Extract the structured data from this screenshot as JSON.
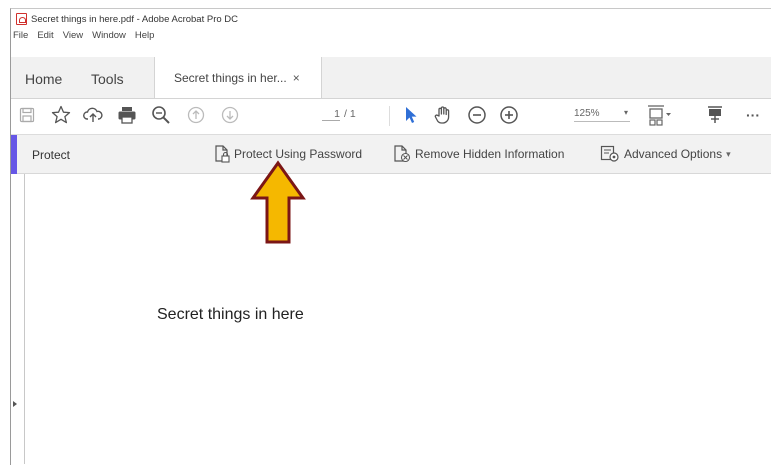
{
  "window": {
    "title": "Secret things in here.pdf - Adobe Acrobat Pro DC"
  },
  "menubar": {
    "items": [
      "File",
      "Edit",
      "View",
      "Window",
      "Help"
    ]
  },
  "tabs": {
    "home": "Home",
    "tools": "Tools",
    "document": "Secret things in her...",
    "close_glyph": "×"
  },
  "toolbar": {
    "page_current": "1",
    "page_total": "/ 1",
    "zoom": "125%",
    "zoom_chevron": "▾",
    "icons": [
      "save-icon",
      "bookmark-star-icon",
      "upload-cloud-icon",
      "print-icon",
      "search-zoom-icon",
      "page-up-icon",
      "page-down-icon",
      "select-cursor-icon",
      "hand-tool-icon",
      "zoom-out-icon",
      "zoom-in-icon",
      "page-display-icon",
      "comment-icon",
      "more-icon"
    ],
    "more": "···",
    "accent_color": "#2f6fd6"
  },
  "protect": {
    "title": "Protect",
    "protect_password": "Protect Using Password",
    "remove_hidden": "Remove Hidden Information",
    "advanced": "Advanced Options",
    "advanced_chevron": "▾",
    "accent_color": "#6657e6"
  },
  "document": {
    "body_text": "Secret things in here"
  },
  "annotation": {
    "arrow_fill": "#f5b800",
    "arrow_stroke": "#7b1616"
  }
}
